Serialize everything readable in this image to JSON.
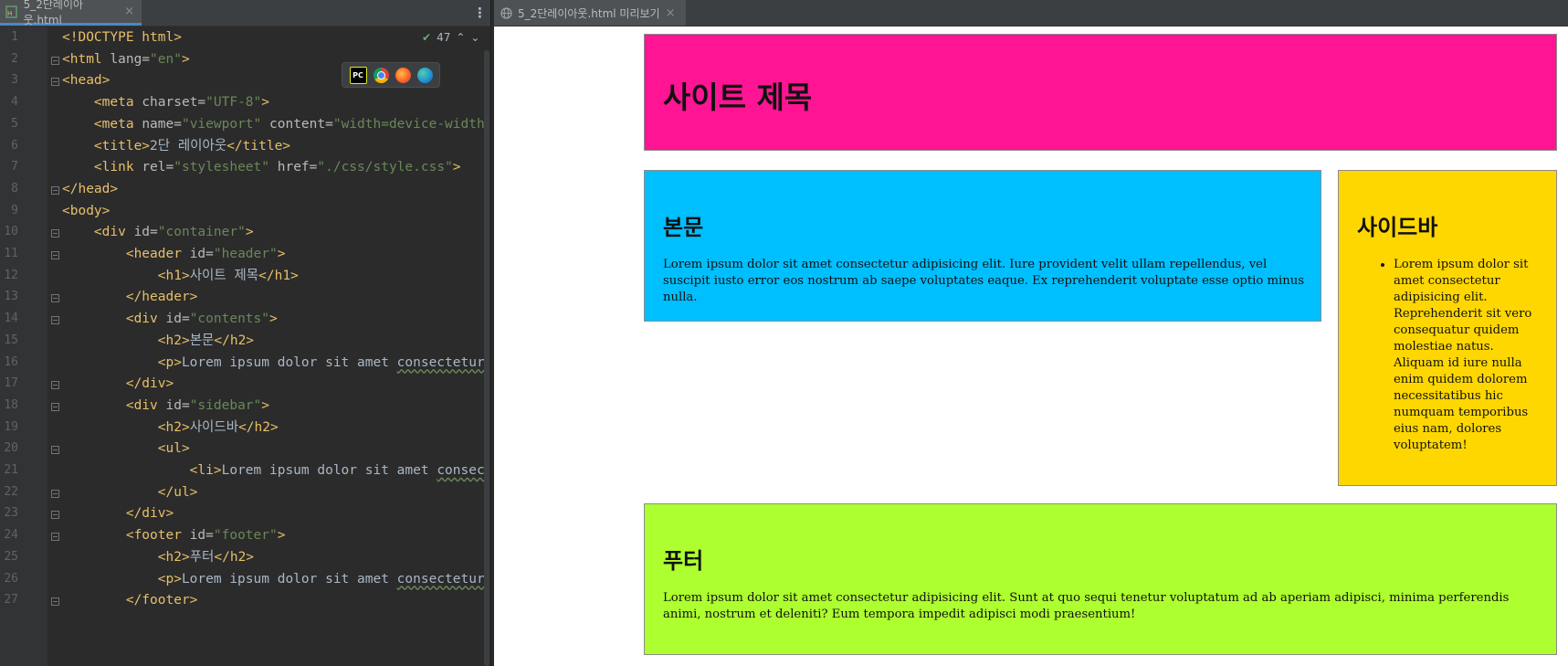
{
  "editor": {
    "tab": {
      "label": "5_2단레이아웃.html",
      "close": "×"
    },
    "inspection": {
      "count": "47"
    },
    "lines": [
      {
        "n": "1",
        "segs": [
          [
            "t",
            "<!DOCTYPE html>"
          ]
        ]
      },
      {
        "n": "2",
        "segs": [
          [
            "t",
            "<html "
          ],
          [
            "a",
            "lang="
          ],
          [
            "v",
            "\"en\""
          ],
          [
            "t",
            ">"
          ]
        ]
      },
      {
        "n": "3",
        "segs": [
          [
            "t",
            "<head>"
          ]
        ]
      },
      {
        "n": "4",
        "segs": [
          [
            "t",
            "    <meta "
          ],
          [
            "a",
            "charset="
          ],
          [
            "v",
            "\"UTF-8\""
          ],
          [
            "t",
            ">"
          ]
        ]
      },
      {
        "n": "5",
        "segs": [
          [
            "t",
            "    <meta "
          ],
          [
            "a",
            "name="
          ],
          [
            "v",
            "\"viewport\" "
          ],
          [
            "a",
            "content="
          ],
          [
            "v",
            "\"width=device-width"
          ]
        ]
      },
      {
        "n": "6",
        "segs": [
          [
            "t",
            "    <title>"
          ],
          [
            "x",
            "2단 레이아웃"
          ],
          [
            "t",
            "</title>"
          ]
        ]
      },
      {
        "n": "7",
        "segs": [
          [
            "t",
            "    <link "
          ],
          [
            "a",
            "rel="
          ],
          [
            "v",
            "\"stylesheet\" "
          ],
          [
            "a",
            "href="
          ],
          [
            "v",
            "\"./css/style.css\""
          ],
          [
            "t",
            ">"
          ]
        ]
      },
      {
        "n": "8",
        "segs": [
          [
            "t",
            "</head>"
          ]
        ]
      },
      {
        "n": "9",
        "segs": [
          [
            "t",
            "<body>"
          ]
        ]
      },
      {
        "n": "10",
        "segs": [
          [
            "t",
            "    <div "
          ],
          [
            "a",
            "id="
          ],
          [
            "v",
            "\"container\""
          ],
          [
            "t",
            ">"
          ]
        ]
      },
      {
        "n": "11",
        "segs": [
          [
            "t",
            "        <header "
          ],
          [
            "a",
            "id="
          ],
          [
            "v",
            "\"header\""
          ],
          [
            "t",
            ">"
          ]
        ]
      },
      {
        "n": "12",
        "segs": [
          [
            "t",
            "            <h1>"
          ],
          [
            "x",
            "사이트 제목"
          ],
          [
            "t",
            "</h1>"
          ]
        ]
      },
      {
        "n": "13",
        "segs": [
          [
            "t",
            "        </header>"
          ]
        ]
      },
      {
        "n": "14",
        "segs": [
          [
            "t",
            "        <div "
          ],
          [
            "a",
            "id="
          ],
          [
            "v",
            "\"contents\""
          ],
          [
            "t",
            ">"
          ]
        ]
      },
      {
        "n": "15",
        "segs": [
          [
            "t",
            "            <h2>"
          ],
          [
            "x",
            "본문"
          ],
          [
            "t",
            "</h2>"
          ]
        ]
      },
      {
        "n": "16",
        "segs": [
          [
            "t",
            "            <p>"
          ],
          [
            "x",
            "Lorem ipsum dolor sit amet "
          ],
          [
            "q",
            "consectetur"
          ]
        ]
      },
      {
        "n": "17",
        "segs": [
          [
            "t",
            "        </div>"
          ]
        ]
      },
      {
        "n": "18",
        "segs": [
          [
            "t",
            "        <div "
          ],
          [
            "a",
            "id="
          ],
          [
            "v",
            "\"sidebar\""
          ],
          [
            "t",
            ">"
          ]
        ]
      },
      {
        "n": "19",
        "segs": [
          [
            "t",
            "            <h2>"
          ],
          [
            "x",
            "사이드바"
          ],
          [
            "t",
            "</h2>"
          ]
        ]
      },
      {
        "n": "20",
        "segs": [
          [
            "t",
            "            <ul>"
          ]
        ]
      },
      {
        "n": "21",
        "segs": [
          [
            "t",
            "                <li>"
          ],
          [
            "x",
            "Lorem ipsum dolor sit amet "
          ],
          [
            "q",
            "consec"
          ]
        ]
      },
      {
        "n": "22",
        "segs": [
          [
            "t",
            "            </ul>"
          ]
        ]
      },
      {
        "n": "23",
        "segs": [
          [
            "t",
            "        </div>"
          ]
        ]
      },
      {
        "n": "24",
        "segs": [
          [
            "t",
            "        <footer "
          ],
          [
            "a",
            "id="
          ],
          [
            "v",
            "\"footer\""
          ],
          [
            "t",
            ">"
          ]
        ]
      },
      {
        "n": "25",
        "segs": [
          [
            "t",
            "            <h2>"
          ],
          [
            "x",
            "푸터"
          ],
          [
            "t",
            "</h2>"
          ]
        ]
      },
      {
        "n": "26",
        "segs": [
          [
            "t",
            "            <p>"
          ],
          [
            "x",
            "Lorem ipsum dolor sit amet "
          ],
          [
            "q",
            "consectetur"
          ]
        ]
      },
      {
        "n": "27",
        "segs": [
          [
            "t",
            "        </footer>"
          ]
        ]
      }
    ],
    "browser_icons": [
      "PC",
      "chrome-icon",
      "firefox-icon",
      "edge-icon"
    ]
  },
  "preview": {
    "tab": {
      "label": "5_2단레이아웃.html 미리보기",
      "close": "×"
    },
    "header": {
      "title": "사이트 제목",
      "color": "#ff1493"
    },
    "contents": {
      "title": "본문",
      "text": "Lorem ipsum dolor sit amet consectetur adipisicing elit. Iure provident velit ullam repellendus, vel suscipit iusto error eos nostrum ab saepe voluptates eaque. Ex reprehenderit voluptate esse optio minus nulla.",
      "color": "#00bfff"
    },
    "sidebar": {
      "title": "사이드바",
      "items": [
        "Lorem ipsum dolor sit amet consectetur adipisicing elit. Reprehenderit sit vero consequatur quidem molestiae natus. Aliquam id iure nulla enim quidem dolorem necessitatibus hic numquam temporibus eius nam, dolores voluptatem!"
      ],
      "color": "#ffd700"
    },
    "footer": {
      "title": "푸터",
      "text": "Lorem ipsum dolor sit amet consectetur adipisicing elit. Sunt at quo sequi tenetur voluptatum ad ab aperiam adipisci, minima perferendis animi, nostrum et deleniti? Eum tempora impedit adipisci modi praesentium!",
      "color": "#adff2f"
    }
  }
}
